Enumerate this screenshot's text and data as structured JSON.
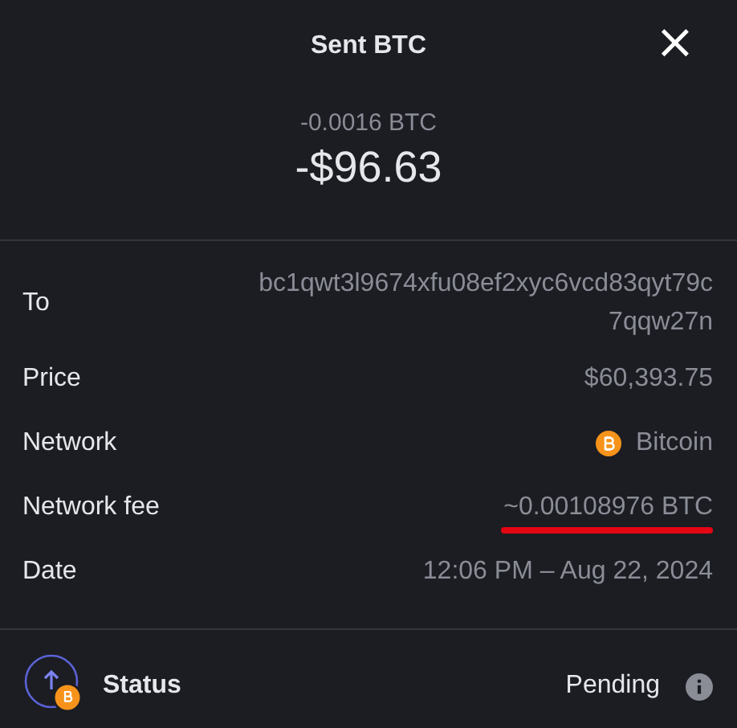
{
  "header": {
    "title": "Sent BTC",
    "close": "×"
  },
  "amount": {
    "crypto": "-0.0016 BTC",
    "fiat": "-$96.63"
  },
  "details": [
    {
      "kind": "text",
      "label": "To",
      "value": "bc1qwt3l9674xfu08ef2xyc6vcd83qyt79c7qqw27n",
      "underlined": false
    },
    {
      "kind": "text",
      "label": "Price",
      "value": "$60,393.75",
      "underlined": false
    },
    {
      "kind": "network",
      "label": "Network",
      "value": "Bitcoin",
      "underlined": false
    },
    {
      "kind": "text",
      "label": "Network fee",
      "value": "~0.00108976 BTC",
      "underlined": true
    },
    {
      "kind": "text",
      "label": "Date",
      "value": "12:06 PM – Aug 22, 2024",
      "underlined": false
    }
  ],
  "status": {
    "label": "Status",
    "value": "Pending"
  }
}
